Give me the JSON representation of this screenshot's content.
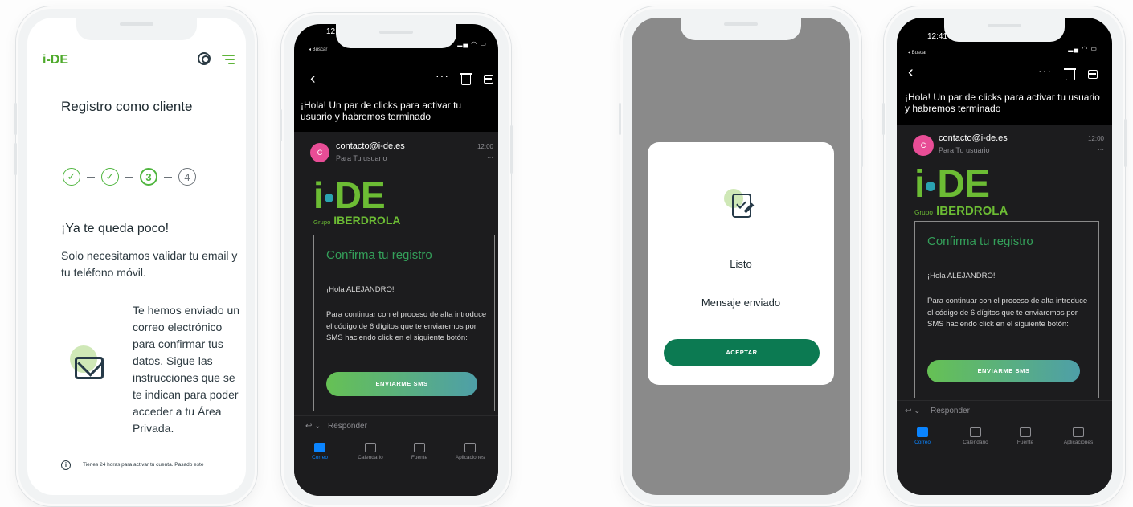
{
  "screen1": {
    "logo": "i-DE",
    "title": "Registro como cliente",
    "steps": [
      "3",
      "4"
    ],
    "heading": "¡Ya te queda poco!",
    "subtitle": "Solo necesitamos validar tu email y tu teléfono móvil.",
    "sent_text": "Te hemos enviado un correo electrónico para confirmar tus datos. Sigue las instrucciones que se te indican para poder acceder a tu Área Privada.",
    "footer_note": "Tienes 24 horas para activar tu cuenta. Pasado este",
    "colors": {
      "brand_green": "#4fb53e",
      "navy": "#263a48"
    }
  },
  "email": {
    "status_time": "12:41",
    "back_label": "◂ Buscar",
    "subject": "¡Hola! Un par de clicks para activar tu usuario y habremos terminado",
    "sender_initial": "C",
    "sender": "contacto@i-de.es",
    "recipient": "Para Tu usuario",
    "time": "12:00",
    "logo_text": "DE",
    "group_prefix": "Grupo",
    "group_name": "IBERDROLA",
    "card_title": "Confirma tu registro",
    "greeting": "¡Hola ALEJANDRO!",
    "body": "Para continuar con el proceso de alta introduce el código de 6 dígitos que te enviaremos por SMS haciendo click en el siguiente botón:",
    "sms_button": "ENVIARME SMS",
    "reply_label": "Responder",
    "tabs": [
      "Correo",
      "Calendario",
      "Fuente",
      "Aplicaciones"
    ],
    "active_tab": "Correo",
    "colors": {
      "accent": "#0a84ff",
      "avatar": "#e84d96",
      "card_title": "#34a05a"
    }
  },
  "dialog": {
    "title": "Listo",
    "message": "Mensaje enviado",
    "button": "ACEPTAR",
    "colors": {
      "button": "#0c7a52"
    }
  }
}
